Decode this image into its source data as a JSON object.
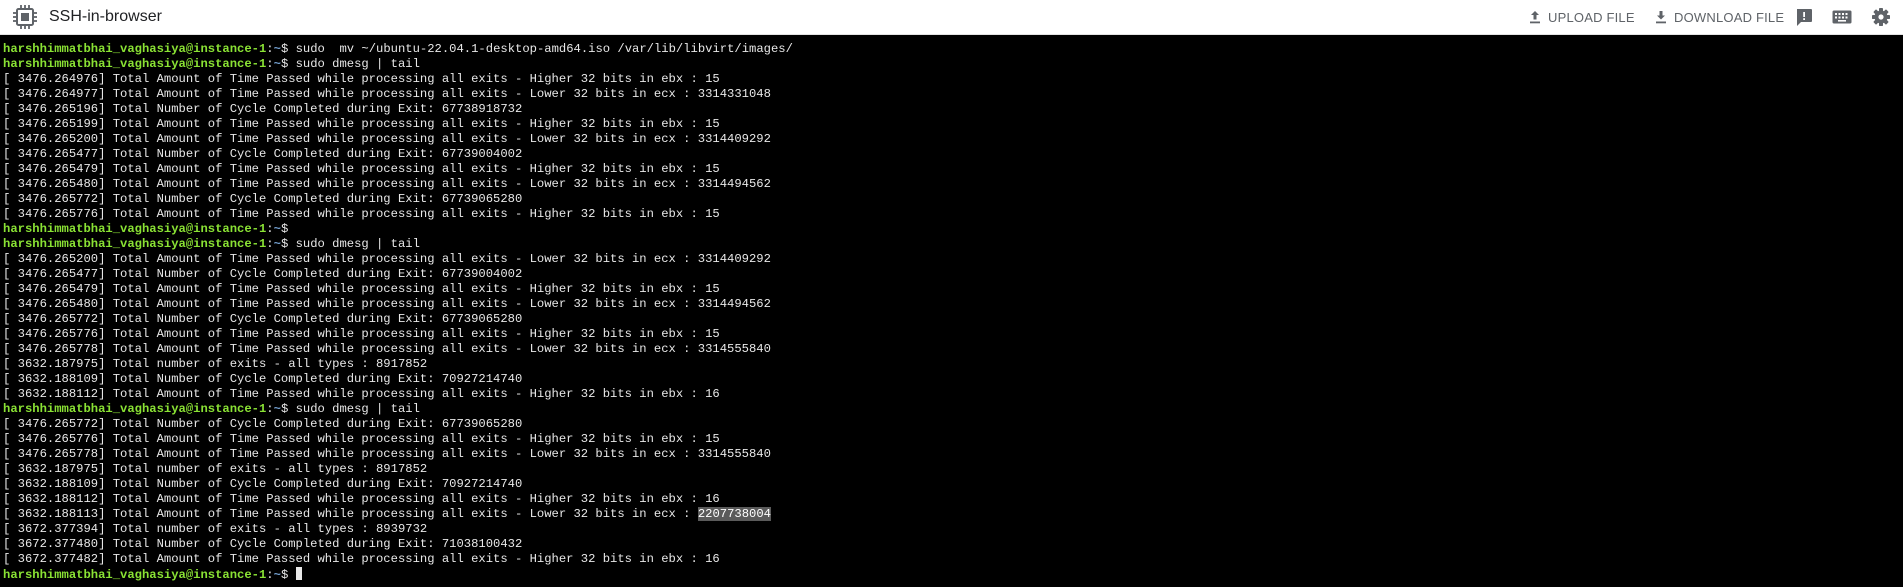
{
  "app": {
    "title": "SSH-in-browser"
  },
  "toolbar": {
    "upload_label": "UPLOAD FILE",
    "download_label": "DOWNLOAD FILE",
    "icons": [
      "chip-logo-icon",
      "upload-icon",
      "download-icon",
      "feedback-icon",
      "keyboard-icon",
      "settings-icon"
    ]
  },
  "colors": {
    "prompt_user": "#8ae234",
    "prompt_path": "#729fcf",
    "terminal_bg": "#000000",
    "terminal_fg": "#e8e8e8"
  },
  "terminal": {
    "prompt": {
      "user_host": "harshhimmatbhai_vaghasiya@instance-1",
      "colon": ":",
      "path": "~",
      "symbol": "$ "
    },
    "lines": [
      {
        "type": "prompt",
        "command": "sudo  mv ~/ubuntu-22.04.1-desktop-amd64.iso /var/lib/libvirt/images/"
      },
      {
        "type": "prompt",
        "command": "sudo dmesg | tail"
      },
      {
        "type": "output",
        "text": "[ 3476.264976] Total Amount of Time Passed while processing all exits - Higher 32 bits in ebx : 15"
      },
      {
        "type": "output",
        "text": "[ 3476.264977] Total Amount of Time Passed while processing all exits - Lower 32 bits in ecx : 3314331048"
      },
      {
        "type": "output",
        "text": "[ 3476.265196] Total Number of Cycle Completed during Exit: 67738918732"
      },
      {
        "type": "output",
        "text": "[ 3476.265199] Total Amount of Time Passed while processing all exits - Higher 32 bits in ebx : 15"
      },
      {
        "type": "output",
        "text": "[ 3476.265200] Total Amount of Time Passed while processing all exits - Lower 32 bits in ecx : 3314409292"
      },
      {
        "type": "output",
        "text": "[ 3476.265477] Total Number of Cycle Completed during Exit: 67739004002"
      },
      {
        "type": "output",
        "text": "[ 3476.265479] Total Amount of Time Passed while processing all exits - Higher 32 bits in ebx : 15"
      },
      {
        "type": "output",
        "text": "[ 3476.265480] Total Amount of Time Passed while processing all exits - Lower 32 bits in ecx : 3314494562"
      },
      {
        "type": "output",
        "text": "[ 3476.265772] Total Number of Cycle Completed during Exit: 67739065280"
      },
      {
        "type": "output",
        "text": "[ 3476.265776] Total Amount of Time Passed while processing all exits - Higher 32 bits in ebx : 15"
      },
      {
        "type": "prompt",
        "command": ""
      },
      {
        "type": "prompt",
        "command": "sudo dmesg | tail"
      },
      {
        "type": "output",
        "text": "[ 3476.265200] Total Amount of Time Passed while processing all exits - Lower 32 bits in ecx : 3314409292"
      },
      {
        "type": "output",
        "text": "[ 3476.265477] Total Number of Cycle Completed during Exit: 67739004002"
      },
      {
        "type": "output",
        "text": "[ 3476.265479] Total Amount of Time Passed while processing all exits - Higher 32 bits in ebx : 15"
      },
      {
        "type": "output",
        "text": "[ 3476.265480] Total Amount of Time Passed while processing all exits - Lower 32 bits in ecx : 3314494562"
      },
      {
        "type": "output",
        "text": "[ 3476.265772] Total Number of Cycle Completed during Exit: 67739065280"
      },
      {
        "type": "output",
        "text": "[ 3476.265776] Total Amount of Time Passed while processing all exits - Higher 32 bits in ebx : 15"
      },
      {
        "type": "output",
        "text": "[ 3476.265778] Total Amount of Time Passed while processing all exits - Lower 32 bits in ecx : 3314555840"
      },
      {
        "type": "output",
        "text": "[ 3632.187975] Total number of exits - all types : 8917852"
      },
      {
        "type": "output",
        "text": "[ 3632.188109] Total Number of Cycle Completed during Exit: 70927214740"
      },
      {
        "type": "output",
        "text": "[ 3632.188112] Total Amount of Time Passed while processing all exits - Higher 32 bits in ebx : 16"
      },
      {
        "type": "prompt",
        "command": "sudo dmesg | tail"
      },
      {
        "type": "output",
        "text": "[ 3476.265772] Total Number of Cycle Completed during Exit: 67739065280"
      },
      {
        "type": "output",
        "text": "[ 3476.265776] Total Amount of Time Passed while processing all exits - Higher 32 bits in ebx : 15"
      },
      {
        "type": "output",
        "text": "[ 3476.265778] Total Amount of Time Passed while processing all exits - Lower 32 bits in ecx : 3314555840"
      },
      {
        "type": "output",
        "text": "[ 3632.187975] Total number of exits - all types : 8917852"
      },
      {
        "type": "output",
        "text": "[ 3632.188109] Total Number of Cycle Completed during Exit: 70927214740"
      },
      {
        "type": "output",
        "text": "[ 3632.188112] Total Amount of Time Passed while processing all exits - Higher 32 bits in ebx : 16"
      },
      {
        "type": "output",
        "text": "[ 3632.188113] Total Amount of Time Passed while processing all exits - Lower 32 bits in ecx : ",
        "selected": "2207738004"
      },
      {
        "type": "output",
        "text": "[ 3672.377394] Total number of exits - all types : 8939732"
      },
      {
        "type": "output",
        "text": "[ 3672.377480] Total Number of Cycle Completed during Exit: 71038100432"
      },
      {
        "type": "output",
        "text": "[ 3672.377482] Total Amount of Time Passed while processing all exits - Higher 32 bits in ebx : 16"
      },
      {
        "type": "prompt",
        "command": "",
        "cursor": true
      }
    ]
  }
}
